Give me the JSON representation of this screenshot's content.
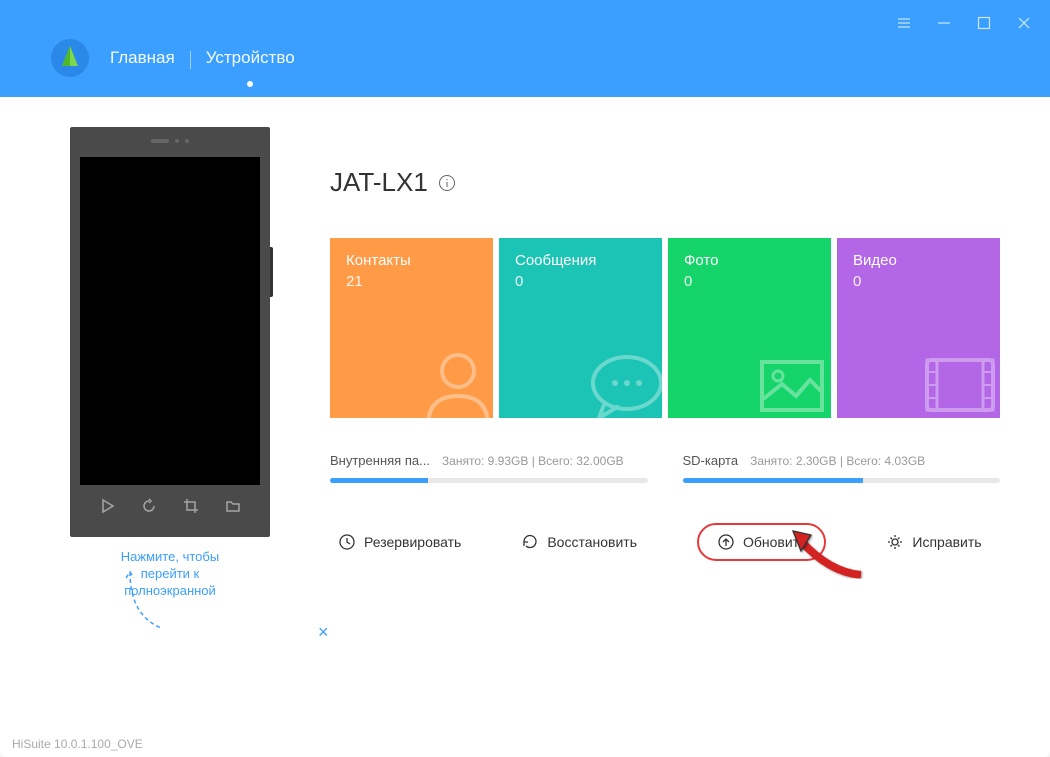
{
  "header": {
    "nav": {
      "home": "Главная",
      "device": "Устройство"
    }
  },
  "device": {
    "name": "JAT-LX1"
  },
  "tiles": {
    "contacts": {
      "label": "Контакты",
      "count": "21"
    },
    "messages": {
      "label": "Сообщения",
      "count": "0"
    },
    "photos": {
      "label": "Фото",
      "count": "0"
    },
    "videos": {
      "label": "Видео",
      "count": "0"
    }
  },
  "storage": {
    "internal": {
      "name": "Внутренняя па...",
      "used_label": "Занято: 9.93GB",
      "total_label": "Всего: 32.00GB",
      "pct": 31
    },
    "sd": {
      "name": "SD-карта",
      "used_label": "Занято: 2.30GB",
      "total_label": "Всего: 4.03GB",
      "pct": 57
    }
  },
  "actions": {
    "backup": "Резервировать",
    "restore": "Восстановить",
    "update": "Обновить",
    "repair": "Исправить"
  },
  "hint": {
    "text": "Нажмите, чтобы перейти к полноэкранной"
  },
  "footer": {
    "version": "HiSuite 10.0.1.100_OVE"
  }
}
